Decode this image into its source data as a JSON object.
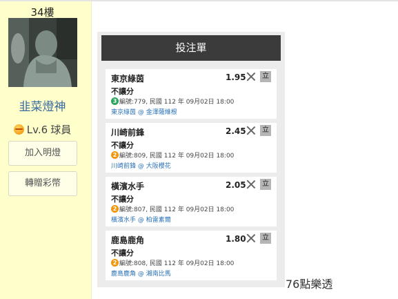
{
  "sidebar": {
    "floor": "34樓",
    "username": "韭菜燈神",
    "level": "Lv.6",
    "rank": "球員",
    "buttons": [
      "加入明燈",
      "轉贈彩幣"
    ]
  },
  "background_text": "76點樂透",
  "bet_slip": {
    "title": "投注單",
    "stand_label": "立",
    "cards": [
      {
        "team": "東京綠茵",
        "odds": "1.95",
        "type": "不讓分",
        "badge": "3",
        "badge_color": "#2aa55a",
        "info": "編號:779, 民國 112 年 09月02日 18:00",
        "home": "東京綠茵",
        "at": "@",
        "away": "金澤薩維根"
      },
      {
        "team": "川崎前鋒",
        "odds": "2.45",
        "type": "不讓分",
        "badge": "2",
        "badge_color": "#f0960a",
        "info": "編號:809, 民國 112 年 09月02日 18:00",
        "home": "川崎前鋒",
        "at": "@",
        "away": "大阪櫻花"
      },
      {
        "team": "橫濱水手",
        "odds": "2.05",
        "type": "不讓分",
        "badge": "2",
        "badge_color": "#f0960a",
        "info": "編號:807, 民國 112 年 09月02日 18:00",
        "home": "橫濱水手",
        "at": "@",
        "away": "柏雷素爾"
      },
      {
        "team": "鹿島鹿角",
        "odds": "1.80",
        "type": "不讓分",
        "badge": "2",
        "badge_color": "#f0960a",
        "info": "編號:808, 民國 112 年 09月02日 18:00",
        "home": "鹿島鹿角",
        "at": "@",
        "away": "湘南比馬"
      }
    ]
  }
}
